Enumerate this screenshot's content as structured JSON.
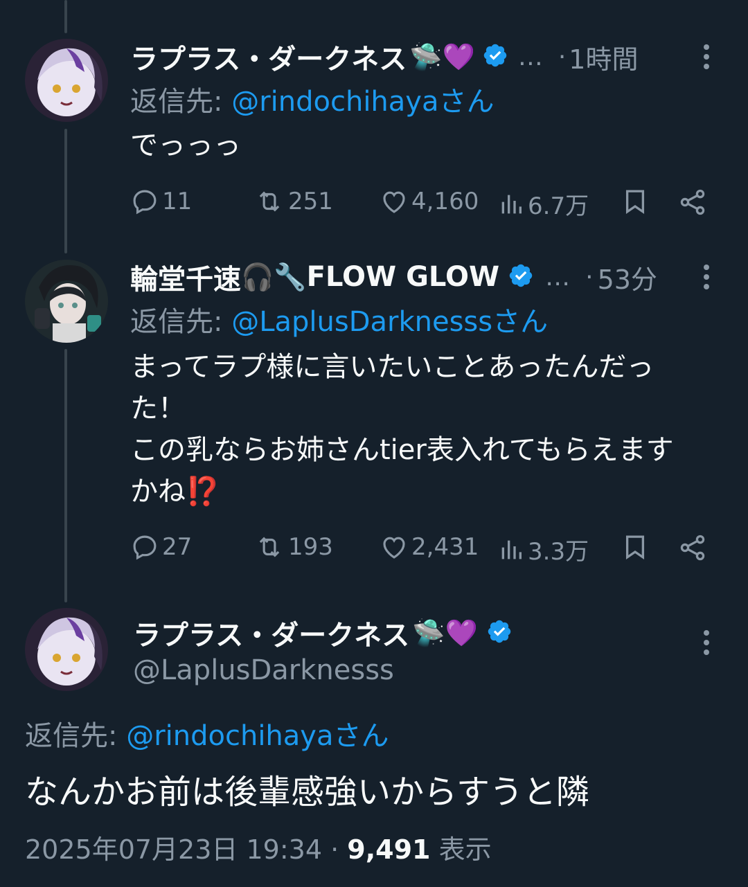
{
  "tweets": [
    {
      "name": "ラプラス・ダークネス",
      "name_emoji": "🛸💜",
      "truncation": "…",
      "separator": "·",
      "time": "1時間",
      "reply_prefix": "返信先:",
      "reply_handle": "@rindochihayaさん",
      "text": "でっっっ",
      "replies": "11",
      "retweets": "251",
      "likes": "4,160",
      "views": "6.7万"
    },
    {
      "name": "輪堂千速",
      "name_emoji": "🎧🔧",
      "name_suffix": "FLOW GLOW",
      "truncation": "…",
      "separator": "·",
      "time": "53分",
      "reply_prefix": "返信先:",
      "reply_handle": "@LaplusDarknesssさん",
      "text_line1": "まってラプ様に言いたいことあったんだっ",
      "text_line2": "た！",
      "text_line3": "この乳ならお姉さんtier表入れてもらえます",
      "text_line4": "かね⁉️",
      "replies": "27",
      "retweets": "193",
      "likes": "2,431",
      "views": "3.3万"
    }
  ],
  "main": {
    "name": "ラプラス・ダークネス",
    "name_emoji": "🛸💜",
    "handle": "@LaplusDarknesss",
    "reply_prefix": "返信先:",
    "reply_handle": "@rindochihayaさん",
    "text": "なんかお前は後輩感強いからすうと隣",
    "timestamp": "2025年07月23日 19:34",
    "separator": "·",
    "views_count": "9,491",
    "views_label": "表示"
  },
  "colors": {
    "background": "#15202b",
    "link": "#1d9bf0",
    "muted": "#8b98a5",
    "verified": "#1d9bf0"
  }
}
